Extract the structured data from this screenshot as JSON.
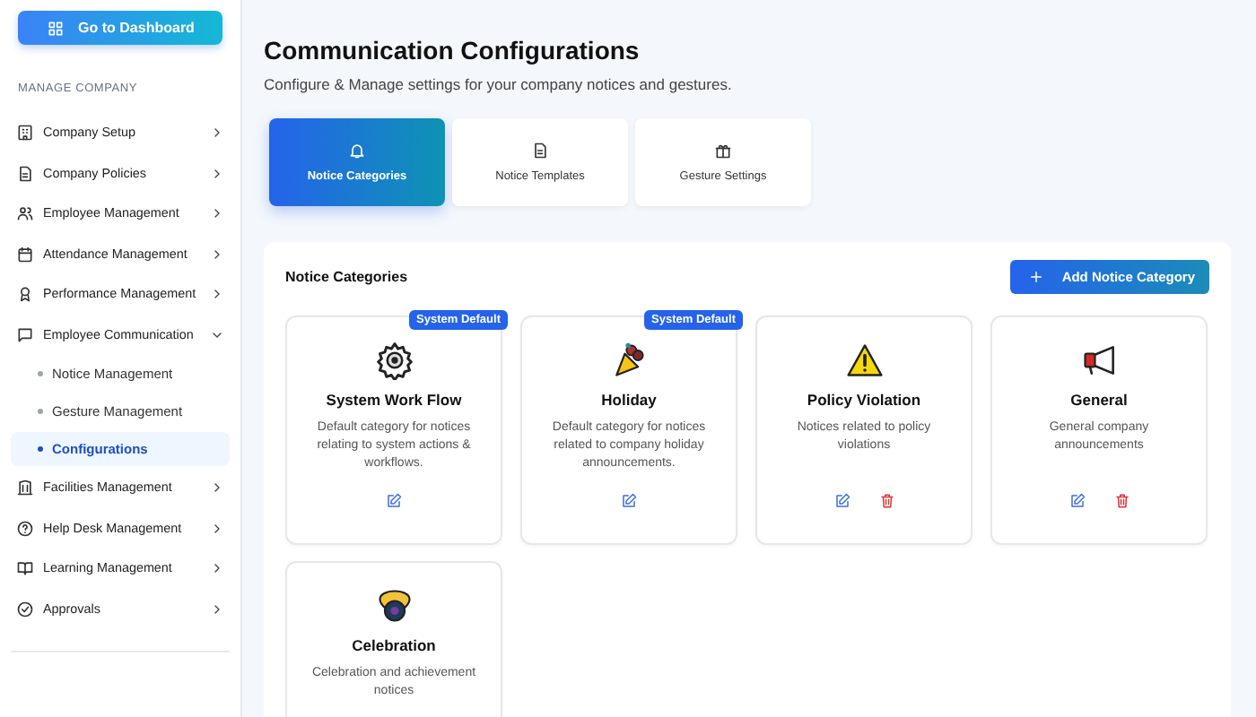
{
  "sidebar": {
    "dashboard_button": "Go to Dashboard",
    "section_title": "MANAGE COMPANY",
    "items": [
      {
        "label": "Company Setup",
        "expanded": false
      },
      {
        "label": "Company Policies",
        "expanded": false
      },
      {
        "label": "Employee Management",
        "expanded": false
      },
      {
        "label": "Attendance Management",
        "expanded": false
      },
      {
        "label": "Performance Management",
        "expanded": false
      },
      {
        "label": "Employee Communication",
        "expanded": true,
        "children": [
          {
            "label": "Notice Management",
            "selected": false
          },
          {
            "label": "Gesture Management",
            "selected": false
          },
          {
            "label": "Configurations",
            "selected": true
          }
        ]
      },
      {
        "label": "Facilities Management",
        "expanded": false
      },
      {
        "label": "Help Desk Management",
        "expanded": false
      },
      {
        "label": "Learning Management",
        "expanded": false
      },
      {
        "label": "Approvals",
        "expanded": false
      }
    ]
  },
  "page": {
    "title": "Communication Configurations",
    "subtitle": "Configure & Manage settings for your company notices and gestures."
  },
  "tabs": [
    {
      "label": "Notice Categories",
      "selected": true
    },
    {
      "label": "Notice Templates",
      "selected": false
    },
    {
      "label": "Gesture Settings",
      "selected": false
    }
  ],
  "panel": {
    "title": "Notice Categories",
    "add_button": "Add Notice Category",
    "cards": [
      {
        "title": "System Work Flow",
        "description": "Default category for notices relating to system actions & workflows.",
        "badge": "System Default",
        "editable": true,
        "deletable": false
      },
      {
        "title": "Holiday",
        "description": "Default category for notices related to company holiday announcements.",
        "badge": "System Default",
        "editable": true,
        "deletable": false
      },
      {
        "title": "Policy Violation",
        "description": "Notices related to policy violations",
        "editable": true,
        "deletable": true
      },
      {
        "title": "General",
        "description": "General company announcements",
        "editable": true,
        "deletable": true
      },
      {
        "title": "Celebration",
        "description": "Celebration and achievement notices"
      }
    ]
  }
}
